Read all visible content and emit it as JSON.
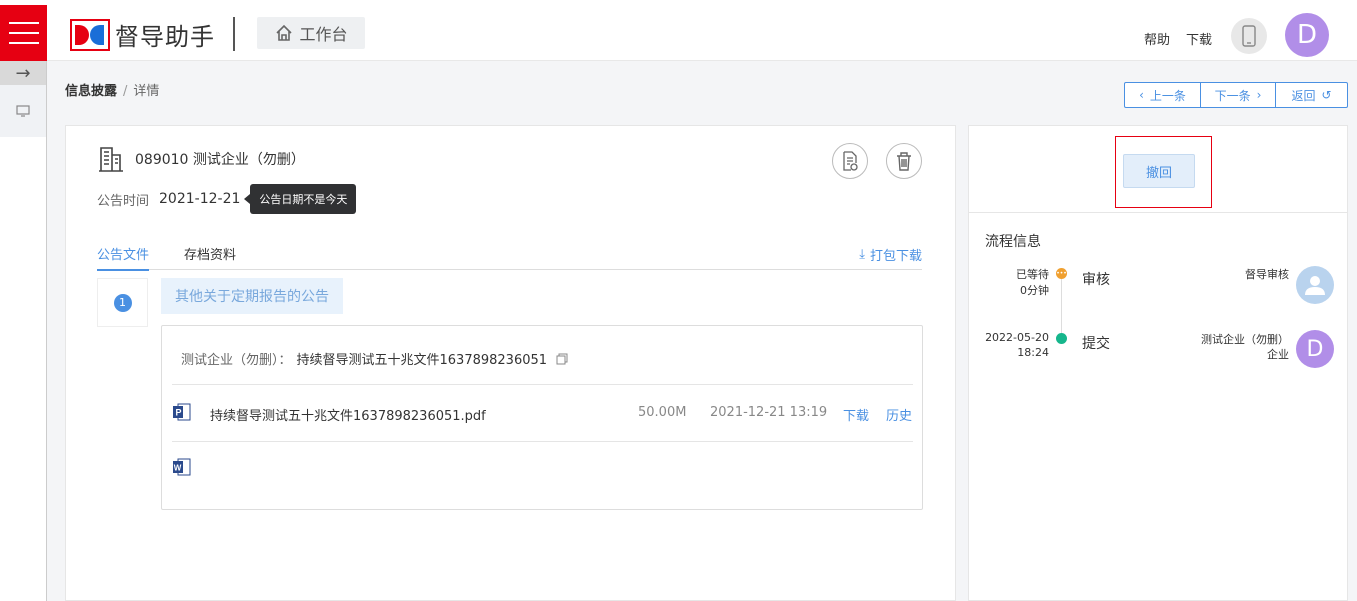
{
  "header": {
    "app_name": "督导助手",
    "workbench_label": "工作台",
    "help": "帮助",
    "download": "下载",
    "avatar_letter": "D"
  },
  "breadcrumb": {
    "root": "信息披露",
    "separator": "/",
    "current": "详情"
  },
  "nav": {
    "prev": "上一条",
    "next": "下一条",
    "back": "返回"
  },
  "detail": {
    "company": "089010  测试企业（勿删）",
    "date_label": "公告时间",
    "date_value": "2021-12-21",
    "tooltip": "公告日期不是今天",
    "tabs": [
      "公告文件",
      "存档资料"
    ],
    "pack_download": "打包下载",
    "item_number": "1",
    "category_label": "其他关于定期报告的公告",
    "file_header_company": "测试企业（勿删）：",
    "file_header_name": "持续督导测试五十兆文件1637898236051",
    "file": {
      "name": "持续督导测试五十兆文件1637898236051.pdf",
      "size": "50.00M",
      "time": "2021-12-21 13:19",
      "download": "下载",
      "history": "历史"
    }
  },
  "right": {
    "revoke": "撤回",
    "flow_title": "流程信息",
    "steps": [
      {
        "line1": "已等待",
        "line2": "0分钟",
        "name": "审核",
        "role1": "督导审核",
        "role2": ""
      },
      {
        "line1": "2022-05-20",
        "line2": "18:24",
        "name": "提交",
        "role1": "测试企业（勿删）",
        "role2": "企业",
        "avatar_letter": "D"
      }
    ]
  },
  "colors": {
    "brand_red": "#e60012",
    "accent_blue": "#4a90e2",
    "pending_orange": "#f0a030",
    "done_green": "#16b68c",
    "avatar_purple": "#b18ee8"
  }
}
